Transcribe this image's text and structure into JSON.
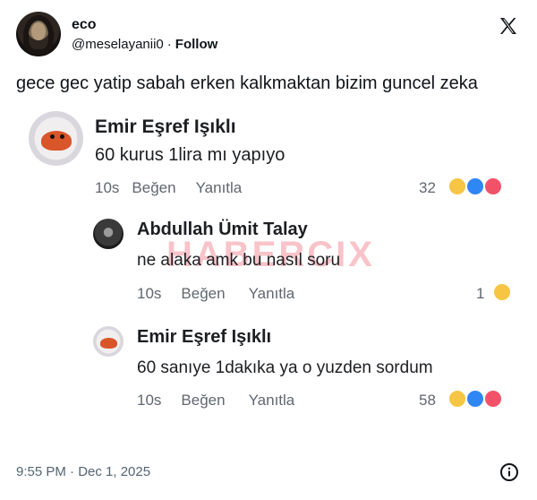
{
  "tweet": {
    "author_name": "eco",
    "handle": "@meselayanii0",
    "separator": "·",
    "follow_label": "Follow",
    "text": "gece gec yatip sabah erken kalkmaktan bizim guncel zeka",
    "timestamp": "9:55 PM · Dec 1, 2025"
  },
  "embedded": {
    "watermark": "HABERCIX",
    "comments": [
      {
        "author": "Emir Eşref Işıklı",
        "text": "60 kurus 1lira mı yapıyo",
        "time": "10s",
        "like_label": "Beğen",
        "reply_label": "Yanıtla",
        "reaction_count": "32",
        "reactions": [
          "haha",
          "like",
          "love"
        ]
      },
      {
        "author": "Abdullah Ümit Talay",
        "text": "ne alaka amk bu nasıl soru",
        "time": "10s",
        "like_label": "Beğen",
        "reply_label": "Yanıtla",
        "reaction_count": "1",
        "reactions": [
          "haha"
        ]
      },
      {
        "author": "Emir Eşref Işıklı",
        "text": "60 sanıye 1dakıka ya o yuzden sordum",
        "time": "10s",
        "like_label": "Beğen",
        "reply_label": "Yanıtla",
        "reaction_count": "58",
        "reactions": [
          "haha",
          "like",
          "love"
        ]
      }
    ]
  },
  "icons": {
    "platform_logo": "x-logo-icon",
    "info": "info-icon"
  },
  "colors": {
    "text_primary": "#0f1419",
    "text_secondary": "#536471",
    "fb_meta": "#606770",
    "haha": "#f7c544",
    "like": "#2f86f5",
    "love": "#f25268",
    "watermark": "#e6283c"
  }
}
